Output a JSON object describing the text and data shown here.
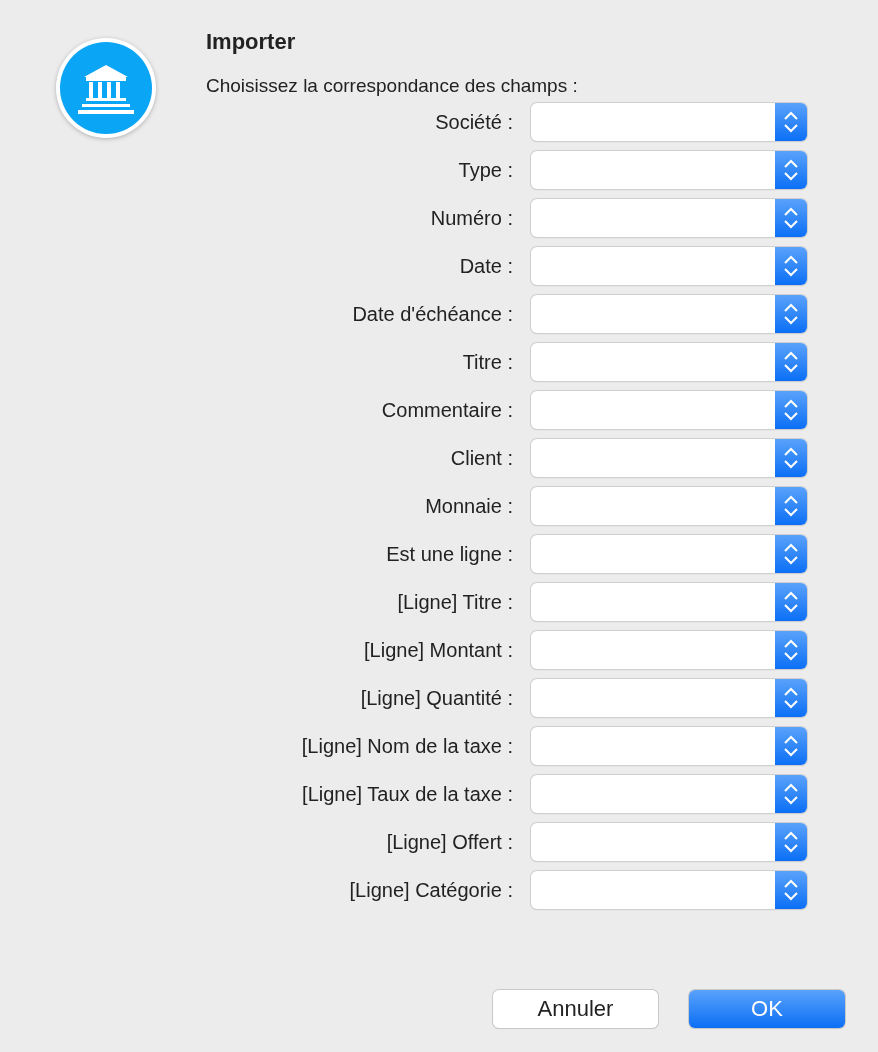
{
  "dialog": {
    "title": "Importer",
    "message": "Choisissez la correspondance des champs :"
  },
  "fields": [
    {
      "label": "Société :"
    },
    {
      "label": "Type :"
    },
    {
      "label": "Numéro :"
    },
    {
      "label": "Date :"
    },
    {
      "label": "Date d'échéance :"
    },
    {
      "label": "Titre :"
    },
    {
      "label": "Commentaire :"
    },
    {
      "label": "Client :"
    },
    {
      "label": "Monnaie :"
    },
    {
      "label": "Est une ligne :"
    },
    {
      "label": "[Ligne] Titre :"
    },
    {
      "label": "[Ligne] Montant :"
    },
    {
      "label": "[Ligne] Quantité :"
    },
    {
      "label": "[Ligne] Nom de la taxe :"
    },
    {
      "label": "[Ligne] Taux de la taxe :"
    },
    {
      "label": "[Ligne] Offert :"
    },
    {
      "label": "[Ligne] Catégorie :"
    }
  ],
  "buttons": [
    {
      "label": "Annuler",
      "default": false
    },
    {
      "label": "OK",
      "default": true
    }
  ]
}
